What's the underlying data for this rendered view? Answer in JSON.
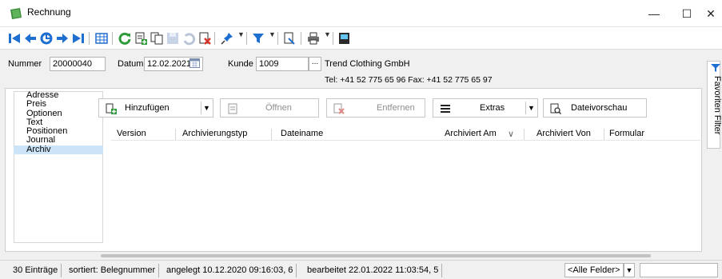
{
  "window": {
    "title": "Rechnung",
    "minimize": "—",
    "maximize": "☐",
    "close": "✕"
  },
  "header": {
    "nummer_label": "Nummer",
    "nummer_value": "20000040",
    "datum_label": "Datum",
    "datum_value": "12.02.2021",
    "kunde_label": "Kunde",
    "kunde_value": "1009",
    "kunde_lookup": "...",
    "kunde_name": "Trend Clothing GmbH",
    "kunde_contact": "Tel: +41 52 775 65 96  Fax: +41 52 775 65 97"
  },
  "nav": {
    "items": [
      "Adresse",
      "Preis",
      "Optionen",
      "Text",
      "Positionen",
      "Journal",
      "Archiv"
    ],
    "selected": "Archiv"
  },
  "actions": {
    "add": "Hinzufügen",
    "open": "Öffnen",
    "remove": "Entfernen",
    "extras": "Extras",
    "preview": "Dateivorschau"
  },
  "grid": {
    "columns": [
      "Version",
      "Archivierungstyp",
      "Dateiname",
      "Archiviert Am",
      "Archiviert Von",
      "Formular"
    ],
    "sort_indicator": "∨",
    "rows": []
  },
  "side": {
    "tab_label": "Favoriten Filter"
  },
  "status": {
    "count": "30 Einträge",
    "sort": "sortiert: Belegnummer",
    "created": "angelegt 10.12.2020 09:16:03,  6",
    "edited": "bearbeitet 22.01.2022 11:03:54,  5",
    "field_filter": "<Alle Felder>"
  },
  "colors": {
    "nav_selected": "#cce4f7",
    "toolbar_blue": "#1f6fd1",
    "refresh_green": "#2e9a3c",
    "delete_red": "#d9352b"
  }
}
